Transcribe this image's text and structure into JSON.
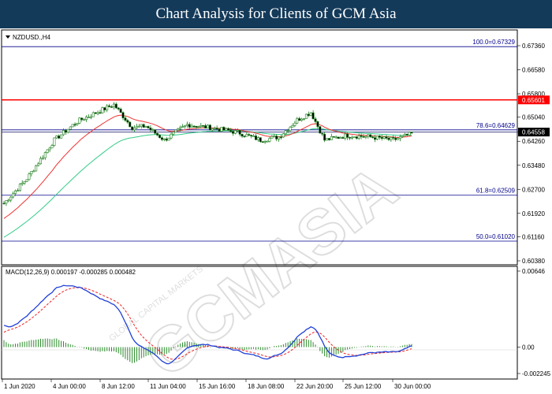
{
  "header": {
    "title": "Chart Analysis for Clients of GCM Asia"
  },
  "chart": {
    "symbol_label": "NZDUSD.,H4",
    "macd_label": "MACD(12,26,9) 0.000197 -0.000285 0.000482",
    "watermark": "GCMASIA",
    "watermark_small": "GLOBAL CAPITAL MARKETS",
    "price_axis": [
      "0.67360",
      "0.66580",
      "0.65800",
      "0.65040",
      "0.64558",
      "0.64260",
      "0.63480",
      "0.62700",
      "0.61920",
      "0.61160",
      "0.60380"
    ],
    "price_badges": {
      "resistance": "0.65601",
      "current": "0.64558"
    },
    "macd_axis": [
      "0.00646",
      "0.00",
      "-0.002245"
    ],
    "time_axis": [
      "1 Jun 2020",
      "4 Jun 00:00",
      "8 Jun 12:00",
      "11 Jun 04:00",
      "15 Jun 16:00",
      "18 Jun 08:00",
      "22 Jun 20:00",
      "25 Jun 12:00",
      "30 Jun 00:00"
    ],
    "fib_levels": [
      {
        "label": "100.0=0.67329",
        "price": 0.67329
      },
      {
        "label": "78.6=0.64629",
        "price": 0.64629
      },
      {
        "label": "61.8=0.62509",
        "price": 0.62509
      },
      {
        "label": "50.0=0.61020",
        "price": 0.6102
      }
    ],
    "levels": {
      "resistance": 0.65601,
      "current": 0.64558
    },
    "colors": {
      "header_bg": "#143a5a",
      "fib_line": "#00008b",
      "resistance_line": "#ff0000",
      "current_line": "#4a4a8a",
      "candle": "#1f7f1f",
      "ma_fast": "#ee3333",
      "ma_slow": "#33cc88",
      "macd_line": "#1f3fd8",
      "signal_line": "#ee2222",
      "histogram": "#2a8a2a"
    }
  }
}
